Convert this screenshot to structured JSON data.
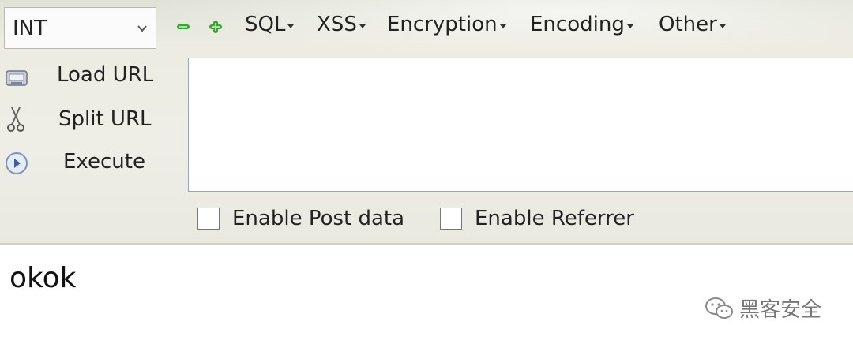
{
  "toolbar": {
    "type_select": {
      "value": "INT"
    },
    "menus": [
      {
        "label": "SQL"
      },
      {
        "label": "XSS"
      },
      {
        "label": "Encryption"
      },
      {
        "label": "Encoding"
      },
      {
        "label": "Other"
      }
    ]
  },
  "side_actions": [
    {
      "label": "Load URL",
      "icon": "load-url-icon"
    },
    {
      "label": "Split URL",
      "icon": "scissors-icon"
    },
    {
      "label": "Execute",
      "icon": "execute-play-icon"
    }
  ],
  "url_input": {
    "value": ""
  },
  "options": {
    "post_data": {
      "label": "Enable Post data",
      "checked": false
    },
    "referrer": {
      "label": "Enable Referrer",
      "checked": false
    }
  },
  "output": {
    "text": "okok"
  },
  "watermark": {
    "text": "黑客安全",
    "icon": "wechat-icon"
  },
  "colors": {
    "zoom_green": "#3ea23a",
    "toolbar_bg": "#ecece2",
    "url_border": "#9aa6b8"
  }
}
